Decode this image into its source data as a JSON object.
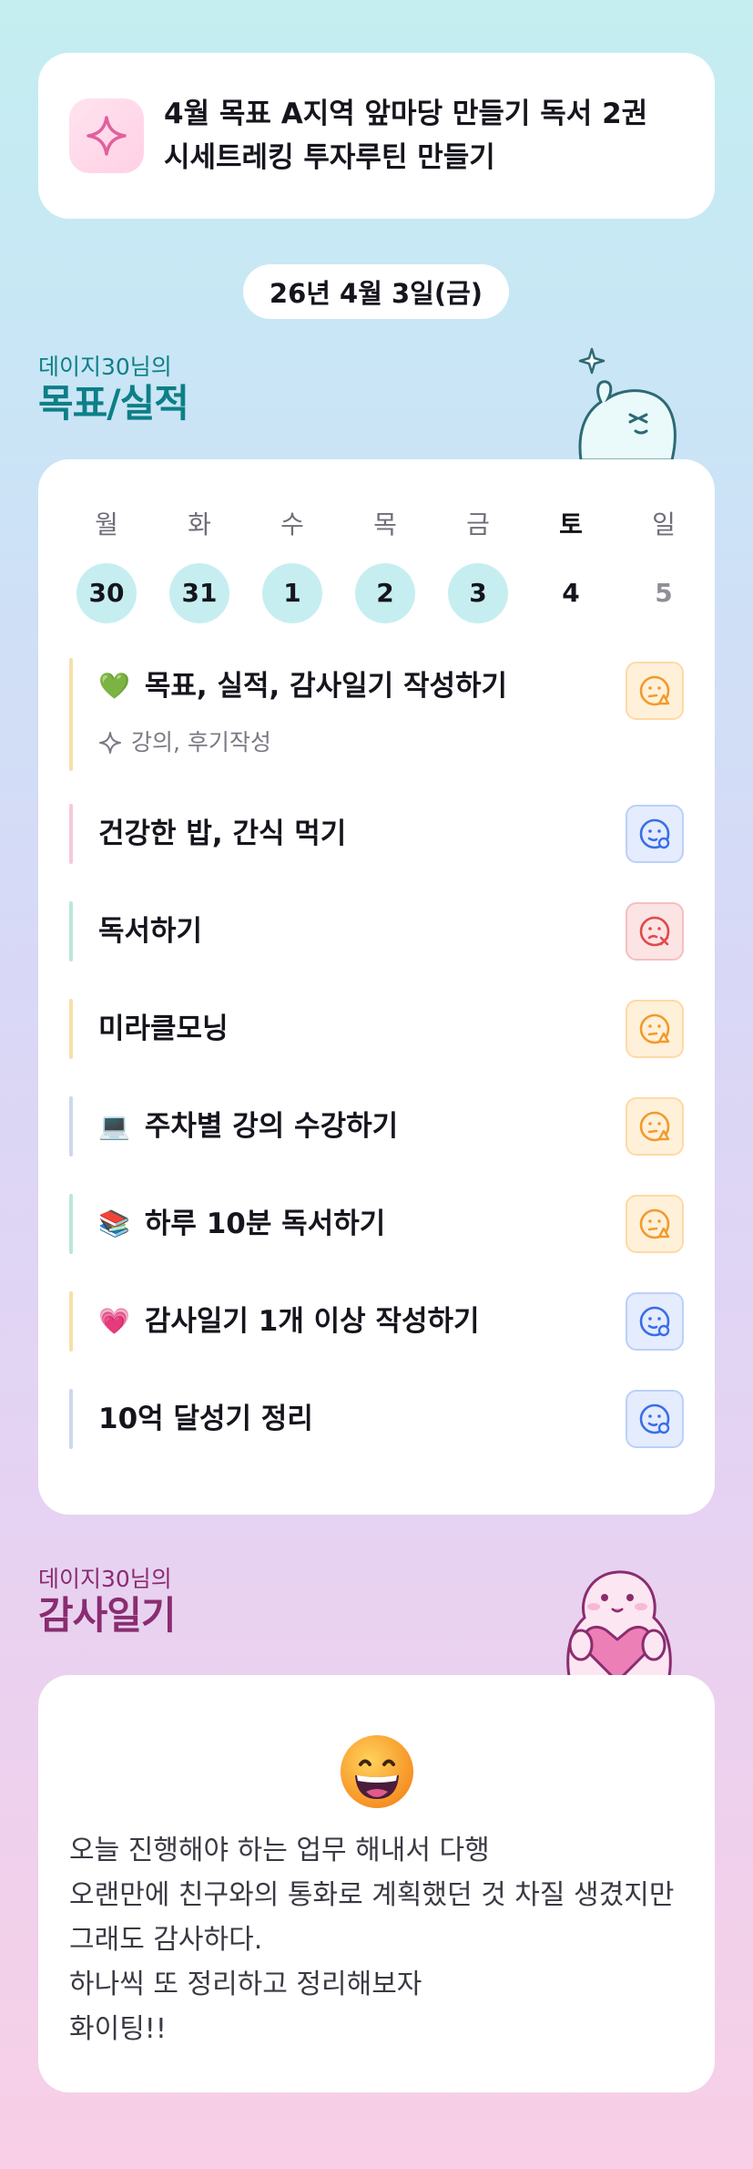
{
  "goal_banner": {
    "icon": "sparkle-icon",
    "line1": "4월 목표 A지역 앞마당 만들기 독서 2권",
    "line2": "시세트레킹 투자루틴 만들기"
  },
  "date": "26년 4월 3일(금)",
  "goals_section": {
    "small_title": "데이지30님의",
    "big_title": "목표/실적"
  },
  "week": [
    {
      "label": "월",
      "num": "30",
      "state": "done"
    },
    {
      "label": "화",
      "num": "31",
      "state": "done"
    },
    {
      "label": "수",
      "num": "1",
      "state": "done"
    },
    {
      "label": "목",
      "num": "2",
      "state": "done"
    },
    {
      "label": "금",
      "num": "3",
      "state": "done"
    },
    {
      "label": "토",
      "num": "4",
      "state": "plain"
    },
    {
      "label": "일",
      "num": "5",
      "state": "sun"
    }
  ],
  "tasks": [
    {
      "emoji": "💚",
      "text": "목표, 실적, 감사일기 작성하기",
      "sub": "강의, 후기작성",
      "status": "orange",
      "status_icon": "face-warning-icon",
      "bar_color": "#f6dfa8"
    },
    {
      "emoji": "",
      "text": "건강한 밥, 간식 먹기",
      "sub": "",
      "status": "blue",
      "status_icon": "face-ok-icon",
      "bar_color": "#f6c8de"
    },
    {
      "emoji": "",
      "text": "독서하기",
      "sub": "",
      "status": "red",
      "status_icon": "face-fail-icon",
      "bar_color": "#b8e8d8"
    },
    {
      "emoji": "",
      "text": "미라클모닝",
      "sub": "",
      "status": "orange",
      "status_icon": "face-warning-icon",
      "bar_color": "#f6dfa8"
    },
    {
      "emoji": "💻",
      "text": "주차별 강의 수강하기",
      "sub": "",
      "status": "orange",
      "status_icon": "face-warning-icon",
      "bar_color": "#cdd8ee"
    },
    {
      "emoji": "📚",
      "text": "하루 10분 독서하기",
      "sub": "",
      "status": "orange",
      "status_icon": "face-warning-icon",
      "bar_color": "#b8e8d8"
    },
    {
      "emoji": "💗",
      "text": "감사일기 1개 이상 작성하기",
      "sub": "",
      "status": "blue",
      "status_icon": "face-ok-icon",
      "bar_color": "#f6dfa8"
    },
    {
      "emoji": "",
      "text": "10억 달성기 정리",
      "sub": "",
      "status": "blue",
      "status_icon": "face-ok-icon",
      "bar_color": "#cdd8ee"
    }
  ],
  "thanks_section": {
    "small_title": "데이지30님의",
    "big_title": "감사일기"
  },
  "thanks": {
    "emoji_icon": "grinning-face-icon",
    "text": "오늘 진행해야 하는 업무 해내서 다행\n오랜만에 친구와의 통화로 계획했던 것 차질 생겼지만 그래도 감사하다.\n하나씩 또 정리하고 정리해보자\n화이팅!!"
  }
}
